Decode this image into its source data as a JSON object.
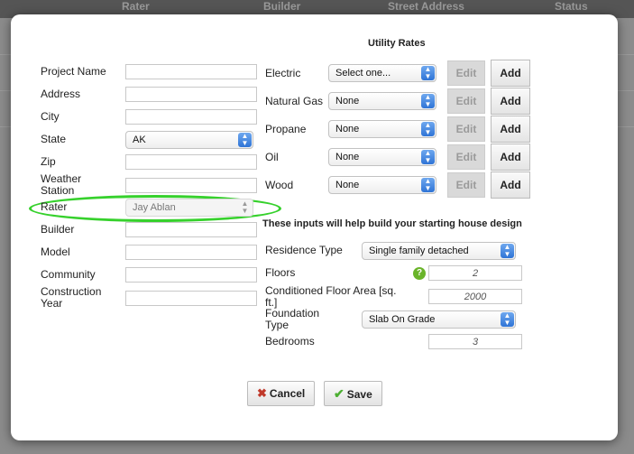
{
  "background": {
    "columns": [
      "Rater",
      "Builder",
      "Street Address",
      "Status"
    ]
  },
  "form": {
    "project_name": {
      "label": "Project Name",
      "value": ""
    },
    "address": {
      "label": "Address",
      "value": ""
    },
    "city": {
      "label": "City",
      "value": ""
    },
    "state": {
      "label": "State",
      "value": "AK"
    },
    "zip": {
      "label": "Zip",
      "value": ""
    },
    "weather_station": {
      "label_line1": "Weather",
      "label_line2": "Station",
      "value": ""
    },
    "rater": {
      "label": "Rater",
      "value": "Jay Ablan"
    },
    "builder": {
      "label": "Builder",
      "value": ""
    },
    "model": {
      "label": "Model",
      "value": ""
    },
    "community": {
      "label": "Community",
      "value": ""
    },
    "construction_year": {
      "label_line1": "Construction",
      "label_line2": "Year",
      "value": ""
    }
  },
  "utility": {
    "title": "Utility Rates",
    "rows": [
      {
        "label": "Electric",
        "value": "Select one..."
      },
      {
        "label": "Natural Gas",
        "value": "None"
      },
      {
        "label": "Propane",
        "value": "None"
      },
      {
        "label": "Oil",
        "value": "None"
      },
      {
        "label": "Wood",
        "value": "None"
      }
    ],
    "edit_label": "Edit",
    "add_label": "Add"
  },
  "house": {
    "title": "These inputs will help build your starting house design",
    "residence_type": {
      "label": "Residence Type",
      "value": "Single family detached"
    },
    "floors": {
      "label": "Floors",
      "value": "2"
    },
    "conditioned_area": {
      "label_line1": "Conditioned Floor Area [sq.",
      "label_line2": "ft.]",
      "value": "2000"
    },
    "foundation_type": {
      "label_line1": "Foundation",
      "label_line2": "Type",
      "value": "Slab On Grade"
    },
    "bedrooms": {
      "label": "Bedrooms",
      "value": "3"
    }
  },
  "footer": {
    "cancel_label": "Cancel",
    "save_label": "Save"
  },
  "colors": {
    "highlight": "#36d12c",
    "select_accent": "#2f74d6"
  },
  "icons": [
    "chevron-updown-icon",
    "help-icon",
    "close-icon",
    "check-icon"
  ]
}
